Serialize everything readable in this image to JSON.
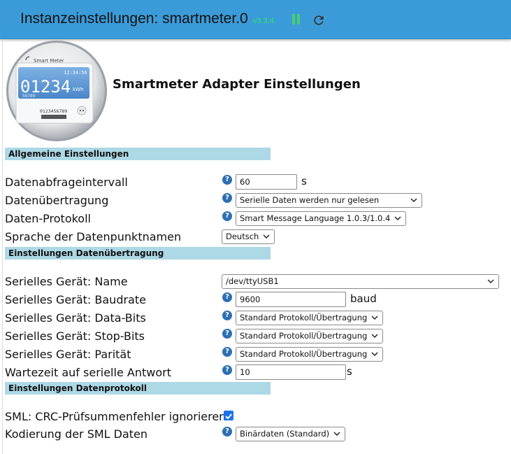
{
  "header": {
    "title": "Instanzeinstellungen: smartmeter.0",
    "version": "v3.3.4",
    "pause_icon": "pause-icon",
    "refresh_icon": "refresh-icon",
    "colors": {
      "bar": "#3b9bd8",
      "version": "#2ee86a",
      "pause": "#45d06e"
    }
  },
  "logo": {
    "brand": "Smart Meter",
    "time": "12:34:56",
    "reading": "01234",
    "unit": "kWh",
    "sub_number": "56789",
    "serial": "0123456789"
  },
  "page_heading": "Smartmeter Adapter Einstellungen",
  "sections": {
    "general": "Allgemeine Einstellungen",
    "transfer": "Einstellungen Datenübertragung",
    "protocol": "Einstellungen Datenprotokoll"
  },
  "general": {
    "interval_label": "Datenabfrageintervall",
    "interval_value": "60",
    "interval_unit": "s",
    "transfer_label": "Datenübertragung",
    "transfer_value": "Serielle Daten werden nur gelesen",
    "protocol_label": "Daten-Protokoll",
    "protocol_value": "Smart Message Language 1.0.3/1.0.4",
    "language_label": "Sprache der Datenpunktnamen",
    "language_value": "Deutsch"
  },
  "transfer": {
    "device_label": "Serielles Gerät: Name",
    "device_value": "/dev/ttyUSB1",
    "baud_label": "Serielles Gerät: Baudrate",
    "baud_value": "9600",
    "baud_unit": "baud",
    "databits_label": "Serielles Gerät: Data-Bits",
    "databits_value": "Standard Protokoll/Übertragung",
    "stopbits_label": "Serielles Gerät: Stop-Bits",
    "stopbits_value": "Standard Protokoll/Übertragung",
    "parity_label": "Serielles Gerät: Parität",
    "parity_value": "Standard Protokoll/Übertragung",
    "wait_label": "Wartezeit auf serielle Antwort",
    "wait_value": "10",
    "wait_unit": "s"
  },
  "protocol": {
    "crc_label": "SML: CRC-Prüfsummenfehler ignorieren",
    "crc_checked": true,
    "encoding_label": "Kodierung der SML Daten",
    "encoding_value": "Binärdaten (Standard)"
  },
  "help_glyph": "?"
}
